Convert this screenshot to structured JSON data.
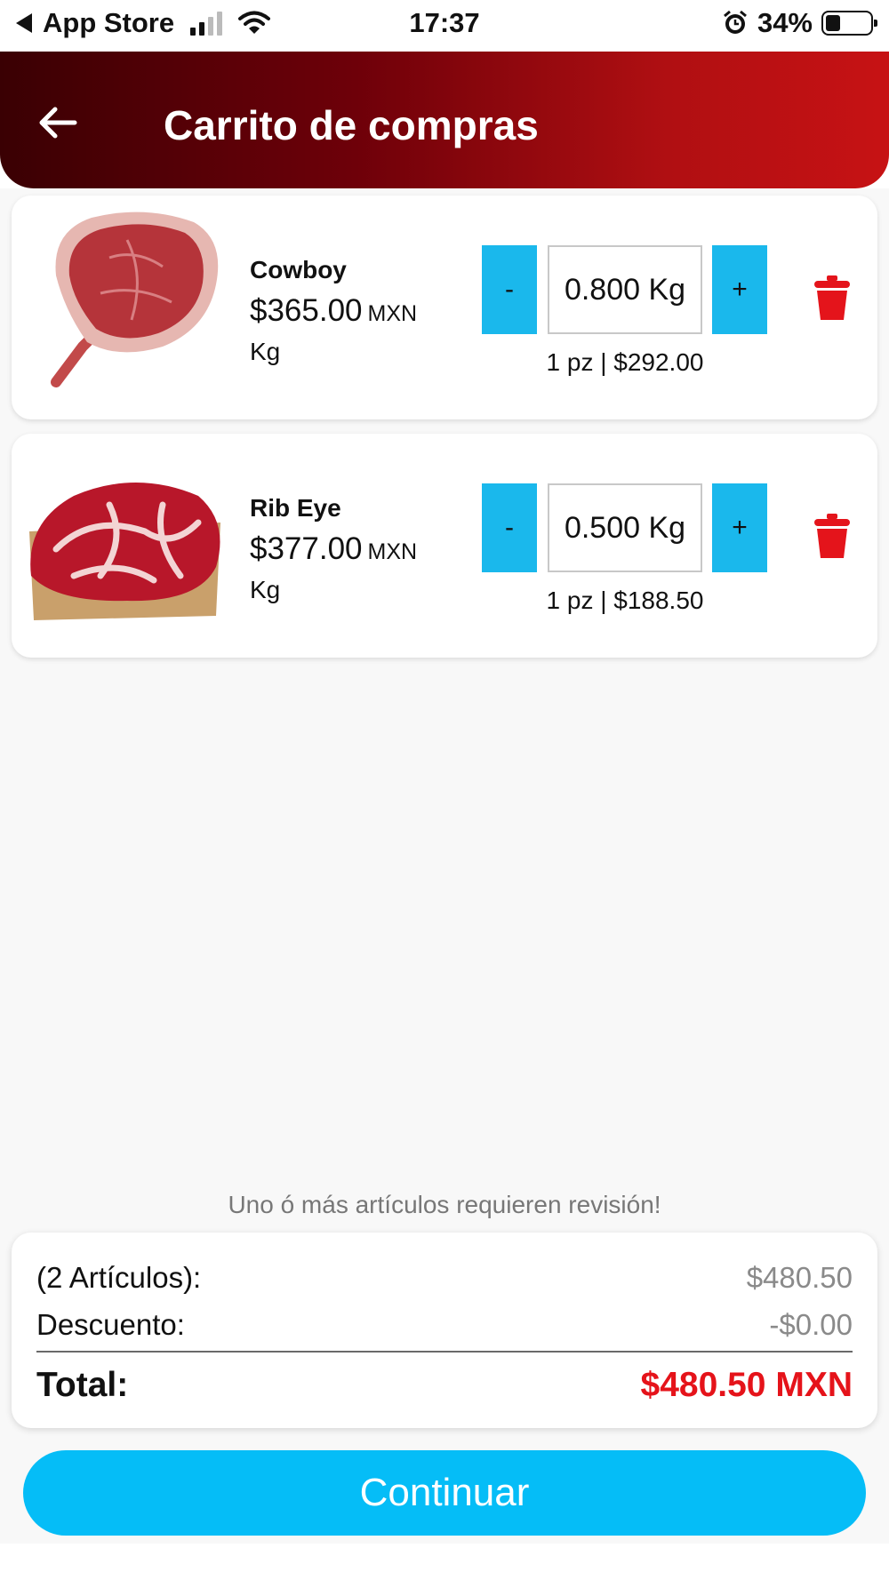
{
  "status_bar": {
    "back_app": "App Store",
    "time": "17:37",
    "battery_percent": "34%",
    "battery_level": 0.34,
    "icons": [
      "signal-icon",
      "wifi-icon",
      "alarm-icon",
      "battery-icon"
    ]
  },
  "header": {
    "title": "Carrito de compras",
    "back_icon": "arrow-left-icon"
  },
  "cart": {
    "items": [
      {
        "name": "Cowboy",
        "price": "$365.00",
        "currency": "MXN",
        "unit": "Kg",
        "minus_label": "-",
        "quantity": "0.800 Kg",
        "plus_label": "+",
        "subtotal": "1 pz | $292.00",
        "delete_icon": "trash-icon"
      },
      {
        "name": "Rib Eye",
        "price": "$377.00",
        "currency": "MXN",
        "unit": "Kg",
        "minus_label": "-",
        "quantity": "0.500 Kg",
        "plus_label": "+",
        "subtotal": "1 pz | $188.50",
        "delete_icon": "trash-icon"
      }
    ],
    "notice": "Uno ó más artículos requieren revisión!"
  },
  "summary": {
    "items_label": "(2 Artículos):",
    "items_value": "$480.50",
    "discount_label": "Descuento:",
    "discount_value": "-$0.00",
    "total_label": "Total:",
    "total_value": "$480.50 MXN"
  },
  "continue_label": "Continuar",
  "colors": {
    "header_dark": "#3a0003",
    "header_red": "#c71214",
    "accent_blue": "#05bdf7",
    "stepper_blue": "#1ab8ec",
    "total_red": "#e5131a",
    "trash_red": "#e4141b"
  }
}
